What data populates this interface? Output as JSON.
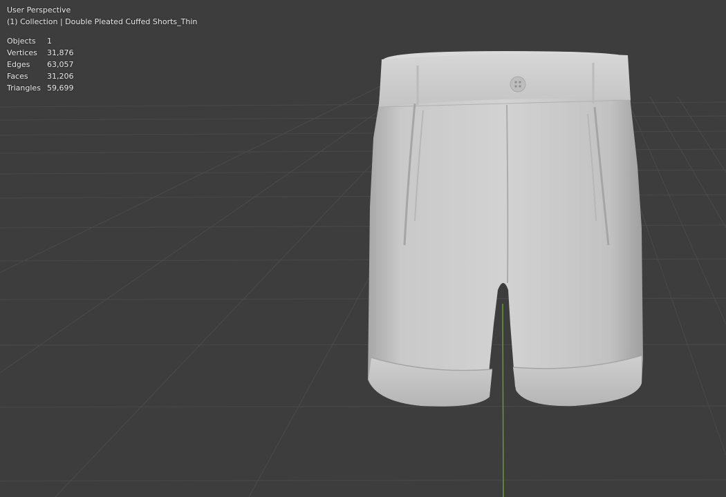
{
  "viewport": {
    "view_name": "User Perspective",
    "collection_text": "(1) Collection | Double Pleated Cuffed Shorts_Thin",
    "stats": [
      {
        "label": "Objects",
        "value": "1"
      },
      {
        "label": "Vertices",
        "value": "31,876"
      },
      {
        "label": "Edges",
        "value": "63,057"
      },
      {
        "label": "Faces",
        "value": "31,206"
      },
      {
        "label": "Triangles",
        "value": "59,699"
      }
    ]
  },
  "colors": {
    "background": "#3d3d3d",
    "grid_line": "#4a4a4a",
    "y_axis": "#6f9a2a",
    "mesh": "#c8c8c8"
  }
}
